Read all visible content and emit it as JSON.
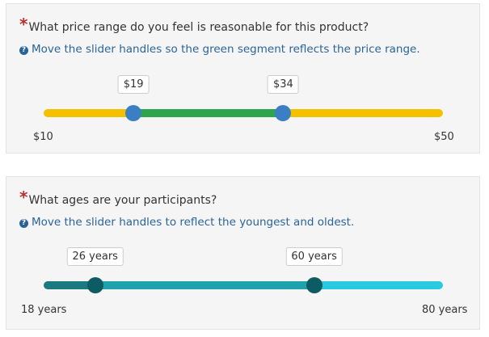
{
  "q1": {
    "required_mark": "*",
    "question": "What price range do you feel is reasonable for this product?",
    "help_icon": "question-circle-icon",
    "help": "Move the slider handles so the green segment reflects the price range.",
    "min": 10,
    "max": 50,
    "low": 19,
    "high": 34,
    "low_label": "$19",
    "high_label": "$34",
    "min_label": "$10",
    "max_label": "$50",
    "colors": {
      "track": "#f5c000",
      "selected": "#2ea44f",
      "handle": "#3a7fc3"
    }
  },
  "q2": {
    "required_mark": "*",
    "question": "What ages are your participants?",
    "help_icon": "question-circle-icon",
    "help": "Move the slider handles to reflect the youngest and oldest.",
    "min": 18,
    "max": 80,
    "low": 26,
    "high": 60,
    "low_label": "26 years",
    "high_label": "60 years",
    "min_label": "18 years",
    "max_label": "80 years",
    "colors": {
      "left": "#1a7a80",
      "selected": "#1fa2ad",
      "right": "#29c9e0",
      "handle": "#0e5c63"
    }
  }
}
